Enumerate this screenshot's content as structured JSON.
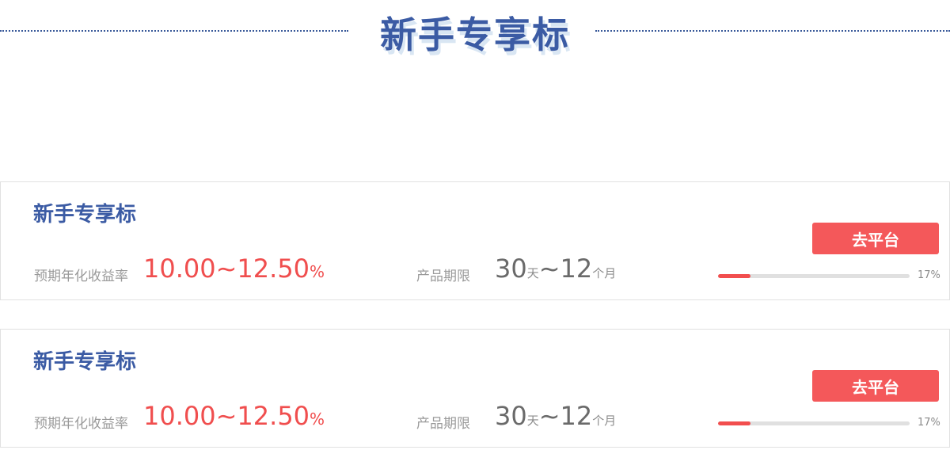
{
  "header": {
    "title": "新手专享标"
  },
  "cards": [
    {
      "title": "新手专享标",
      "rate_label": "预期年化收益率",
      "rate_value": "10.00~12.50",
      "rate_unit": "%",
      "term_label": "产品期限",
      "term_min": "30",
      "term_min_unit": "天",
      "term_sep": "~",
      "term_max": "12",
      "term_max_unit": "个月",
      "button_label": "去平台",
      "progress_percent": 17,
      "progress_text": "17%"
    },
    {
      "title": "新手专享标",
      "rate_label": "预期年化收益率",
      "rate_value": "10.00~12.50",
      "rate_unit": "%",
      "term_label": "产品期限",
      "term_min": "30",
      "term_min_unit": "天",
      "term_sep": "~",
      "term_max": "12",
      "term_max_unit": "个月",
      "button_label": "去平台",
      "progress_percent": 17,
      "progress_text": "17%"
    }
  ],
  "colors": {
    "accent_blue": "#3b5ba4",
    "accent_red": "#f4585a"
  }
}
